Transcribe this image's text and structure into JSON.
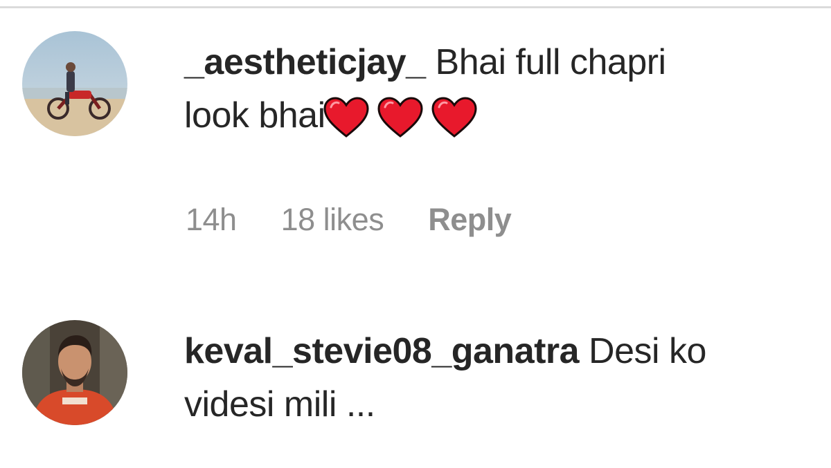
{
  "comments": [
    {
      "username": "_aestheticjay_",
      "text_line1": "Bhai full chapri",
      "text_line2": "look bhai",
      "emoji": [
        "red-heart",
        "red-heart",
        "red-heart"
      ],
      "time": "14h",
      "likes": "18 likes",
      "reply_label": "Reply",
      "avatar_icon": "motorcycle-beach-avatar"
    },
    {
      "username": "keval_stevie08_ganatra",
      "text_line1": "Desi ko",
      "text_line2": "videsi mili ...",
      "avatar_icon": "man-red-shirt-avatar"
    }
  ],
  "colors": {
    "text": "#262626",
    "meta": "#8e8e8e",
    "heart": "#e8192c",
    "divider": "#dbdbdb"
  }
}
